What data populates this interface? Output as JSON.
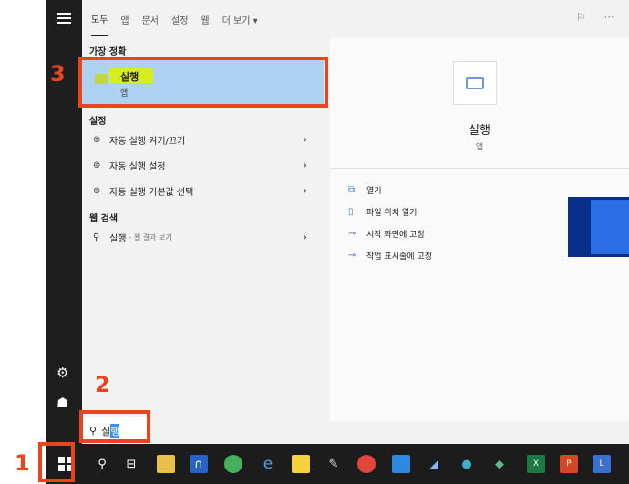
{
  "tabs": [
    "모두",
    "앱",
    "문서",
    "설정",
    "웹",
    "더 보기 ▾"
  ],
  "best_match": {
    "section": "가장 정확",
    "title": "실행",
    "subtitle": "앱"
  },
  "settings": {
    "section": "설정",
    "items": [
      {
        "label": "자동 실행 켜기/끄기"
      },
      {
        "label": "자동 실행 설정"
      },
      {
        "label": "자동 실행 기본값 선택"
      }
    ]
  },
  "web": {
    "section": "웹 검색",
    "query": "실행",
    "suffix": "- 웹 결과 보기"
  },
  "preview": {
    "title": "실행",
    "subtitle": "앱",
    "actions": [
      {
        "label": "열기",
        "icon": "open-icon"
      },
      {
        "label": "파일 위치 열기",
        "icon": "file-icon"
      },
      {
        "label": "시작 화면에 고정",
        "icon": "pin-icon"
      },
      {
        "label": "작업 표시줄에 고정",
        "icon": "pin-icon"
      }
    ]
  },
  "search": {
    "typed": "실",
    "selected": "행"
  },
  "annotations": [
    "1",
    "2",
    "3"
  ],
  "colors": {
    "accent": "#e8451e",
    "selection": "#aed2f2",
    "taskbar": "#1c1c1c"
  }
}
